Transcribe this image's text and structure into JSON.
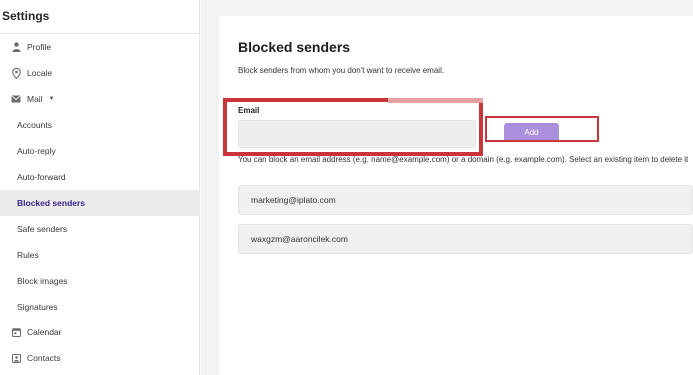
{
  "sidebar": {
    "title": "Settings",
    "items": [
      {
        "label": "Profile",
        "icon": "person-icon"
      },
      {
        "label": "Locale",
        "icon": "location-pin-icon"
      },
      {
        "label": "Mail",
        "icon": "mail-icon"
      },
      {
        "label": "Accounts"
      },
      {
        "label": "Auto-reply"
      },
      {
        "label": "Auto-forward"
      },
      {
        "label": "Blocked senders",
        "active": true
      },
      {
        "label": "Safe senders"
      },
      {
        "label": "Rules"
      },
      {
        "label": "Block images"
      },
      {
        "label": "Signatures"
      },
      {
        "label": "Calendar",
        "icon": "calendar-icon"
      },
      {
        "label": "Contacts",
        "icon": "contacts-icon"
      }
    ]
  },
  "main": {
    "title": "Blocked senders",
    "subtitle": "Block senders from whom you don't want to receive email.",
    "email_label": "Email",
    "email_value": "",
    "add_label": "Add",
    "helper": "You can block an email address (e.g. name@example.com) or a domain (e.g. example.com). Select an existing item to delete it",
    "blocked": [
      "marketing@iplato.com",
      "waxgzm@aaroncilek.com"
    ]
  },
  "colors": {
    "accent": "#3b1f8e",
    "add_button": "#a98fdc",
    "highlight": "#c8353a"
  }
}
